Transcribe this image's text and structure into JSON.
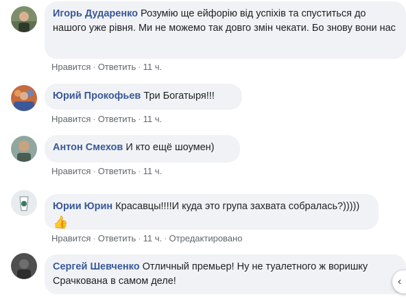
{
  "action_labels": {
    "like": "Нравится",
    "reply": "Ответить",
    "separator": "·",
    "edited": "Отредактировано"
  },
  "comments": [
    {
      "author": "Игорь Дударенко",
      "text": "Розумію ще ейфорію від успіхів та спуститься до нашого уже рівня. Ми не можемо так довго змін чекати. Бо знову вони нас",
      "time": "11 ч."
    },
    {
      "author": "Юрий Прокофьев",
      "text": "Три Богатыря!!!",
      "time": "11 ч."
    },
    {
      "author": "Антон Смехов",
      "text": "И кто ещё шоумен)",
      "time": "11 ч."
    },
    {
      "author": "Юрии Юрин",
      "text": "Красавцы!!!!И куда это група захвата собралась?)))))",
      "emoji": "👍",
      "time": "11 ч."
    },
    {
      "author": "Сергей Шевченко",
      "text": "Отличный премьер! Ну не туалетного ж воришку Срачкована в самом деле!",
      "time": ""
    }
  ],
  "colors": {
    "author": "#385898",
    "bubble": "#f0f2f5",
    "meta": "#606770",
    "text": "#1c1e21"
  }
}
